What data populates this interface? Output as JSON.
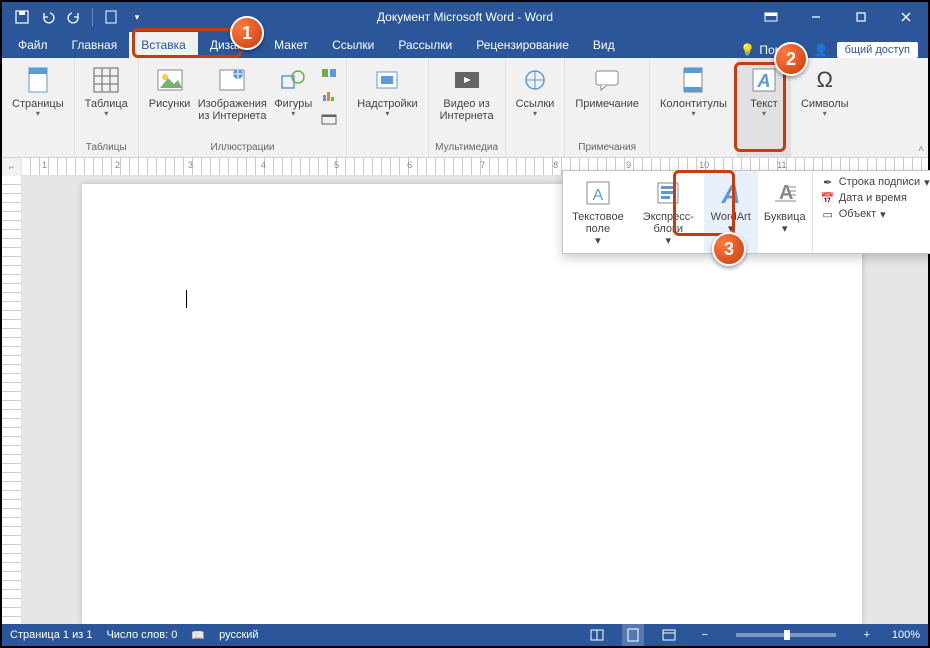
{
  "title": "Документ Microsoft Word - Word",
  "tabs": {
    "file": "Файл",
    "home": "Главная",
    "insert": "Вставка",
    "design": "Дизайн",
    "layout": "Макет",
    "references": "Ссылки",
    "mailings": "Рассылки",
    "review": "Рецензирование",
    "view": "Вид",
    "help": "Помощь",
    "share": "бщий доступ"
  },
  "ribbon": {
    "pages": {
      "label": "Страницы",
      "group": ""
    },
    "tables": {
      "label": "Таблица",
      "group": "Таблицы"
    },
    "illustrations": {
      "pictures": "Рисунки",
      "online_pictures": "Изображения из Интернета",
      "shapes": "Фигуры",
      "group": "Иллюстрации"
    },
    "addins": {
      "label": "Надстройки",
      "group": ""
    },
    "media": {
      "label": "Видео из Интернета",
      "group": "Мультимедиа"
    },
    "links": {
      "label": "Ссылки",
      "group": ""
    },
    "comments": {
      "label": "Примечание",
      "group": "Примечания"
    },
    "headerfooter": {
      "label": "Колонтитулы",
      "group": ""
    },
    "text": {
      "label": "Текст",
      "group": ""
    },
    "symbols": {
      "label": "Символы",
      "group": ""
    }
  },
  "popup": {
    "textbox": "Текстовое поле",
    "quickparts": "Экспресс-блоки",
    "wordart": "WordArt",
    "dropcap": "Буквица",
    "signature_line": "Строка подписи",
    "date_time": "Дата и время",
    "object": "Объект"
  },
  "ruler_numbers": [
    "1",
    "2",
    "3",
    "4",
    "5",
    "6",
    "7",
    "8",
    "9",
    "10",
    "11"
  ],
  "status": {
    "page": "Страница 1 из 1",
    "words": "Число слов: 0",
    "lang": "русский",
    "zoom": "100%"
  },
  "badges": {
    "b1": "1",
    "b2": "2",
    "b3": "3"
  }
}
